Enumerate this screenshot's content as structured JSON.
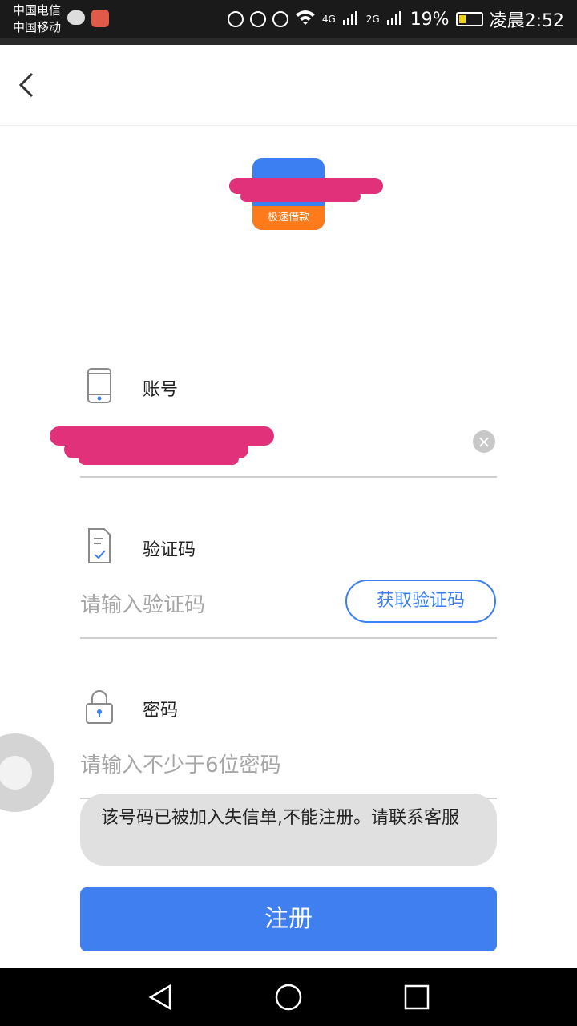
{
  "status_bar": {
    "carrier_1": "中国电信",
    "carrier_2": "中国移动",
    "battery": "19%",
    "time": "凌晨2:52",
    "network_1": "4G",
    "network_2": "2G"
  },
  "logo": {
    "text": "极速借款"
  },
  "account": {
    "label": "账号",
    "icon": "phone-icon"
  },
  "code": {
    "label": "验证码",
    "placeholder": "请输入验证码",
    "button": "获取验证码",
    "icon": "document-check-icon"
  },
  "password": {
    "label": "密码",
    "placeholder": "请输入不少于6位密码",
    "icon": "lock-icon"
  },
  "toast": {
    "message": "该号码已被加入失信单,不能注册。请联系客服"
  },
  "register": {
    "label": "注册"
  },
  "colors": {
    "accent": "#3f7ff0",
    "logo_band": "#ff7a1a"
  }
}
